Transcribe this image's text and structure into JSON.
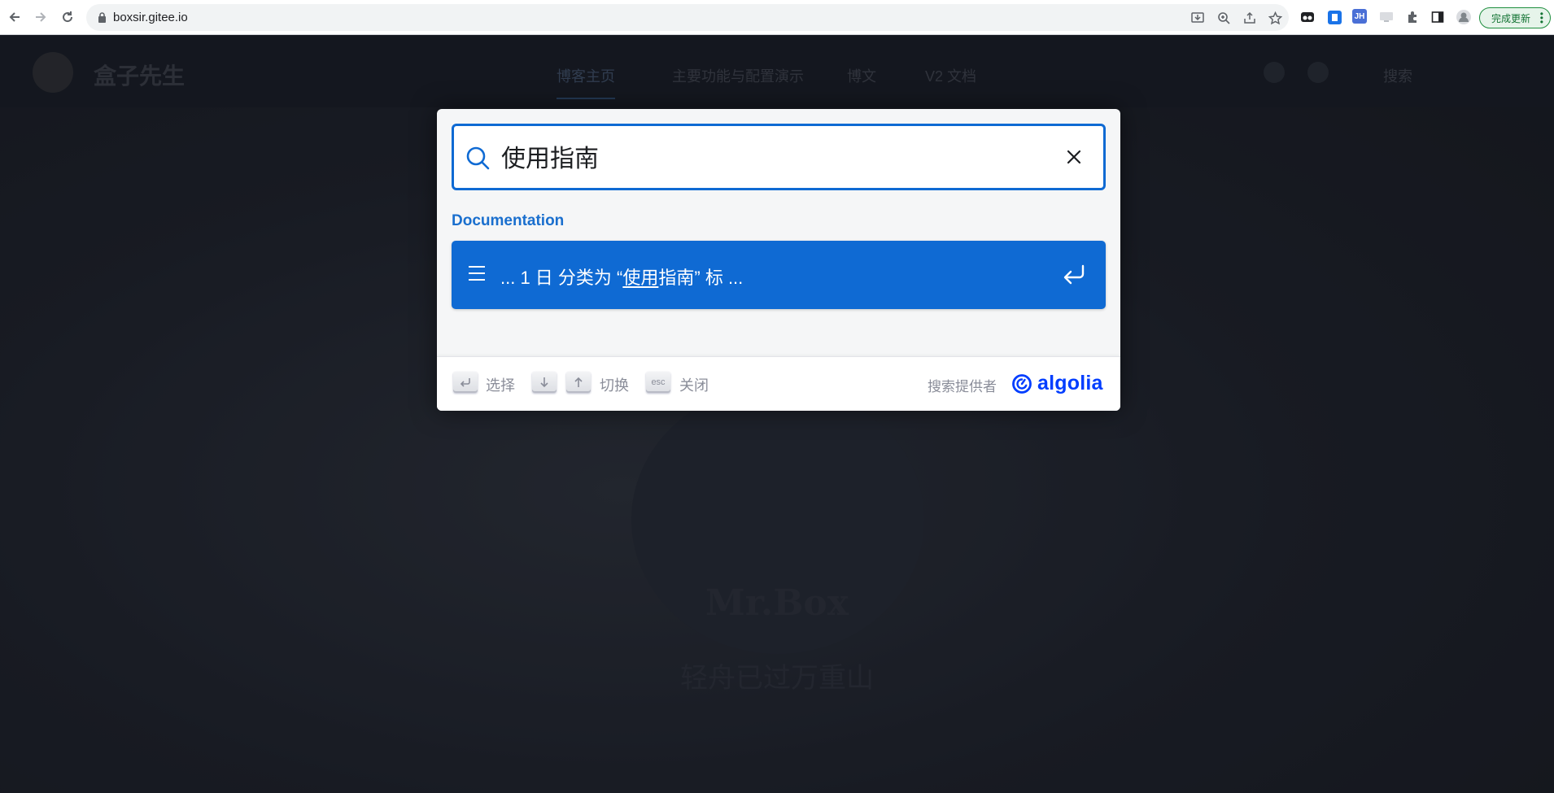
{
  "browser": {
    "url": "boxsir.gitee.io",
    "update_label": "完成更新",
    "ext_jh_label": "JH"
  },
  "site": {
    "title": "盒子先生",
    "nav": [
      "博客主页",
      "主要功能与配置演示",
      "博文",
      "V2 文档"
    ],
    "search_label": "搜索",
    "hero_title": "Mr.Box",
    "hero_subtitle": "轻舟已过万重山"
  },
  "search": {
    "query": "使用指南",
    "section_title": "Documentation",
    "hit": {
      "prefix": "... 1 日 分类为 “",
      "highlight": "使用",
      "after_highlight": "指南",
      "suffix": "” 标 ..."
    }
  },
  "footer": {
    "select_label": "选择",
    "navigate_label": "切换",
    "esc_key": "esc",
    "close_label": "关闭",
    "provider_label": "搜索提供者",
    "provider_name": "algolia"
  },
  "colors": {
    "accent": "#0f6ad3",
    "algolia": "#003dff",
    "update_green": "#137333"
  }
}
